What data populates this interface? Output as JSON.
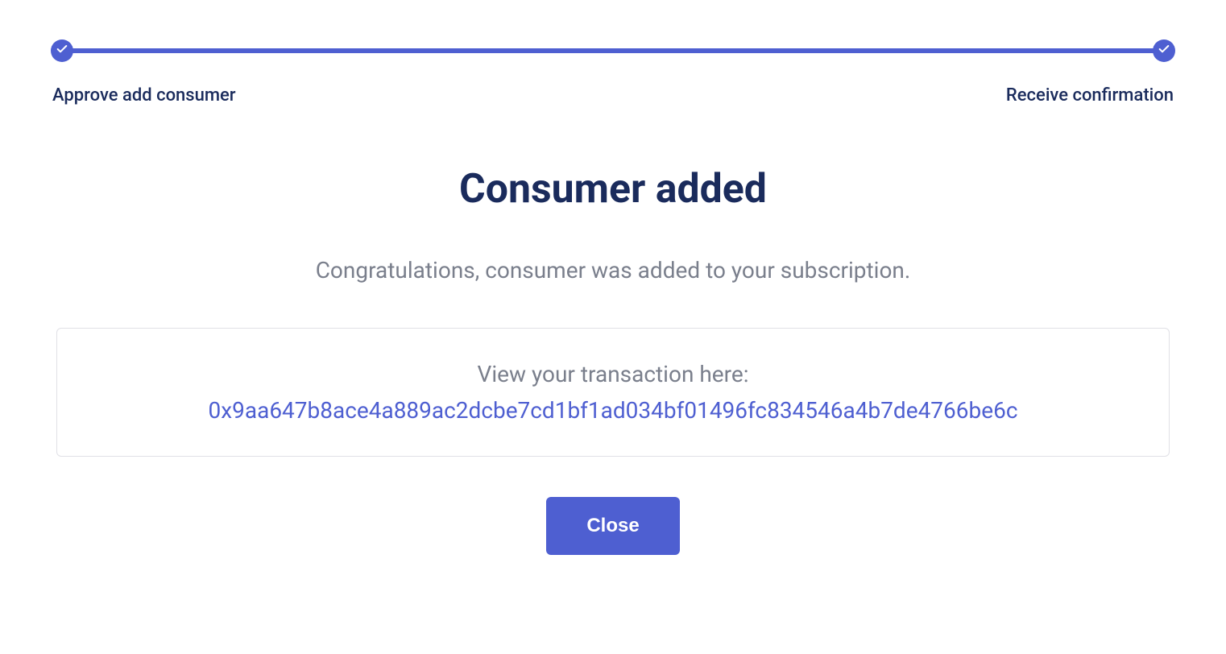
{
  "progress": {
    "step1_label": "Approve add consumer",
    "step2_label": "Receive confirmation"
  },
  "content": {
    "title": "Consumer added",
    "subtitle": "Congratulations, consumer was added to your subscription.",
    "transaction_label": "View your transaction here:",
    "transaction_hash": "0x9aa647b8ace4a889ac2dcbe7cd1bf1ad034bf01496fc834546a4b7de4766be6c",
    "close_button_label": "Close"
  }
}
